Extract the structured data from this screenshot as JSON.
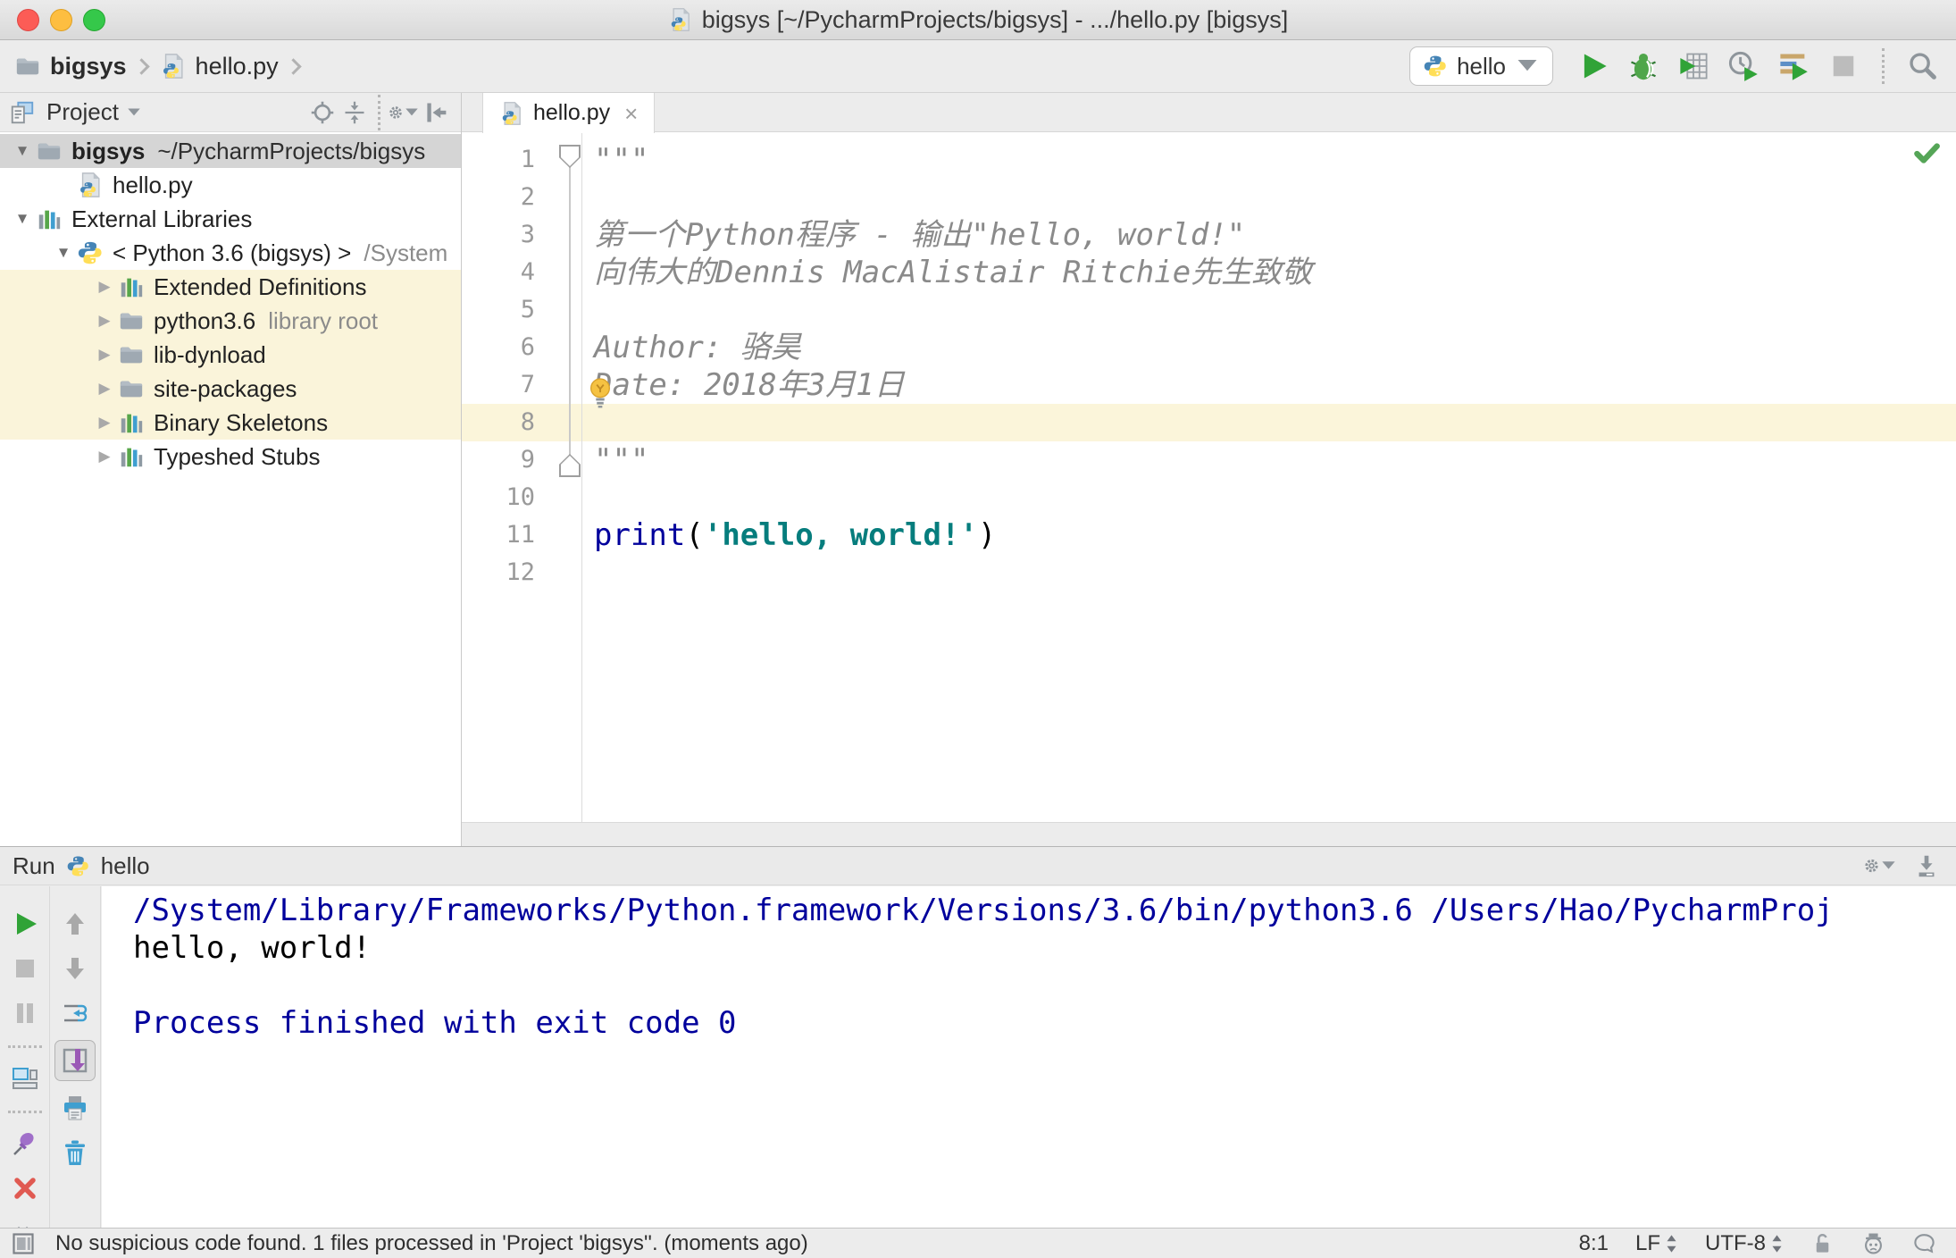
{
  "window": {
    "title": "bigsys [~/PycharmProjects/bigsys] - .../hello.py [bigsys]",
    "traffic_lights": [
      "close",
      "minimize",
      "zoom"
    ]
  },
  "toolbar": {
    "breadcrumbs": [
      {
        "label": "bigsys",
        "icon": "folder",
        "bold": true
      },
      {
        "label": "hello.py",
        "icon": "python-file",
        "bold": false
      }
    ],
    "run_config": {
      "label": "hello",
      "icon": "python"
    },
    "actions": [
      {
        "name": "run",
        "disabled": false
      },
      {
        "name": "debug",
        "disabled": false
      },
      {
        "name": "run-with-coverage",
        "disabled": false
      },
      {
        "name": "profile",
        "disabled": false
      },
      {
        "name": "concurrency-diagram",
        "disabled": false
      },
      {
        "name": "stop",
        "disabled": true
      },
      {
        "type": "separator"
      },
      {
        "name": "search-everywhere",
        "disabled": false
      }
    ]
  },
  "project_panel": {
    "title": "Project",
    "actions": [
      {
        "name": "locate"
      },
      {
        "name": "collapse-all"
      },
      {
        "type": "separator"
      },
      {
        "name": "settings",
        "dropdown": true
      },
      {
        "name": "hide-panel"
      }
    ],
    "tree": [
      {
        "label": "bigsys",
        "annotation": "~/PycharmProjects/bigsys",
        "annotation_dark": true,
        "icon": "folder",
        "arrow": "open",
        "level": 0,
        "selected": true,
        "bold": true
      },
      {
        "label": "hello.py",
        "icon": "python-file",
        "arrow": null,
        "level": 1
      },
      {
        "label": "External Libraries",
        "icon": "library",
        "arrow": "open",
        "level": 0
      },
      {
        "label": "< Python 3.6 (bigsys) >",
        "annotation": "/System",
        "icon": "python",
        "arrow": "open",
        "level": 1
      },
      {
        "label": "Extended Definitions",
        "icon": "library",
        "arrow": "closed",
        "level": 2,
        "highlight": true
      },
      {
        "label": "python3.6",
        "annotation": "library root",
        "icon": "folder",
        "arrow": "closed",
        "level": 2,
        "highlight": true
      },
      {
        "label": "lib-dynload",
        "icon": "folder",
        "arrow": "closed",
        "level": 2,
        "highlight": true
      },
      {
        "label": "site-packages",
        "icon": "folder",
        "arrow": "closed",
        "level": 2,
        "highlight": true
      },
      {
        "label": "Binary Skeletons",
        "icon": "library",
        "arrow": "closed",
        "level": 2,
        "highlight": true
      },
      {
        "label": "Typeshed Stubs",
        "icon": "library",
        "arrow": "closed",
        "level": 2,
        "highlight": false
      }
    ]
  },
  "editor": {
    "tab": {
      "label": "hello.py",
      "icon": "python-file",
      "close": "×",
      "active": true
    },
    "inspection_status": "no-problems-green-check",
    "lines": [
      {
        "num": 1,
        "segments": [
          {
            "text": "\"\"\"",
            "style": "docstring"
          }
        ]
      },
      {
        "num": 2,
        "segments": []
      },
      {
        "num": 3,
        "segments": [
          {
            "text": "第一个Python程序 - 输出\"hello, world!\"",
            "style": "docstring"
          }
        ]
      },
      {
        "num": 4,
        "segments": [
          {
            "text": "向伟大的Dennis MacAlistair Ritchie先生致敬",
            "style": "docstring"
          }
        ]
      },
      {
        "num": 5,
        "segments": []
      },
      {
        "num": 6,
        "segments": [
          {
            "text": "Author: 骆昊",
            "style": "docstring"
          }
        ]
      },
      {
        "num": 7,
        "segments": [
          {
            "text": "Date: 2018年3月1日",
            "style": "docstring"
          }
        ],
        "bulb": true
      },
      {
        "num": 8,
        "segments": [],
        "highlight": true
      },
      {
        "num": 9,
        "segments": [
          {
            "text": "\"\"\"",
            "style": "docstring"
          }
        ]
      },
      {
        "num": 10,
        "segments": []
      },
      {
        "num": 11,
        "segments": [
          {
            "text": "print",
            "style": "keyword"
          },
          {
            "text": "(",
            "style": "plain"
          },
          {
            "text": "'hello, world!'",
            "style": "string"
          },
          {
            "text": ")",
            "style": "plain"
          }
        ]
      },
      {
        "num": 12,
        "segments": []
      }
    ]
  },
  "run_panel": {
    "title": "Run",
    "config": {
      "label": "hello",
      "icon": "python"
    },
    "header_actions": [
      {
        "name": "settings",
        "dropdown": true
      },
      {
        "name": "scroll-down"
      }
    ],
    "toolbar_primary": [
      {
        "name": "rerun"
      },
      {
        "name": "stop",
        "disabled": true
      },
      {
        "name": "pause-output",
        "disabled": true
      },
      {
        "type": "separator"
      },
      {
        "name": "restore-layout"
      },
      {
        "type": "separator"
      },
      {
        "name": "pin-tab"
      },
      {
        "name": "close"
      },
      {
        "name": "more-options"
      }
    ],
    "toolbar_secondary": [
      {
        "name": "up-stack-trace"
      },
      {
        "name": "down-stack-trace"
      },
      {
        "name": "soft-wrap"
      },
      {
        "name": "scroll-to-end",
        "pressed": true
      },
      {
        "name": "print"
      },
      {
        "name": "clear-all"
      }
    ],
    "console": [
      {
        "text": "/System/Library/Frameworks/Python.framework/Versions/3.6/bin/python3.6 /Users/Hao/PycharmProj",
        "style": "system"
      },
      {
        "text": "hello, world!",
        "style": "stdout"
      },
      {
        "text": "",
        "style": "stdout"
      },
      {
        "text": "Process finished with exit code 0",
        "style": "system"
      }
    ]
  },
  "status_bar": {
    "message": "No suspicious code found. 1 files processed in 'Project 'bigsys''. (moments ago)",
    "caret_position": "8:1",
    "line_separator": "LF",
    "encoding": "UTF-8",
    "icons": [
      "unlock",
      "hector",
      "feedback-bubble"
    ]
  },
  "colors": {
    "keyword": "#00009c",
    "string": "#067d7d",
    "docstring": "#8a8a8a",
    "console_system": "#00009c",
    "current_line": "#fbf5da",
    "library_highlight": "#faf4da",
    "selection": "#d5d5d5",
    "run_green": "#30a337",
    "check_green": "#55a557"
  }
}
